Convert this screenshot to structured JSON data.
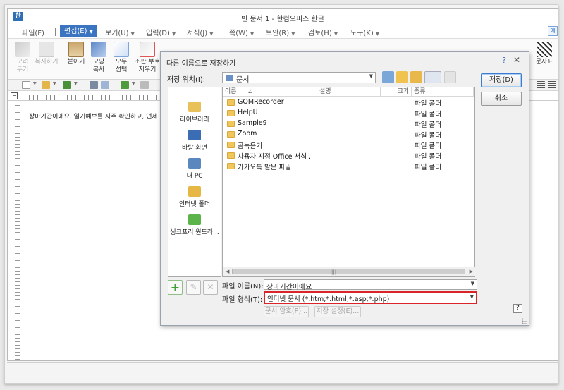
{
  "window": {
    "title": "빈 문서 1 - 한컴오피스 한글"
  },
  "menu": {
    "file": "파일(F)",
    "edit": "편집(E)",
    "view": "보기(U)",
    "input": "입력(D)",
    "format": "서식(J)",
    "page": "쪽(W)",
    "security": "보안(R)",
    "review": "검토(H)",
    "tools": "도구(K)"
  },
  "ribbon": {
    "cut": "오려\n두기",
    "copy": "복사하기",
    "paste": "붙이기",
    "shape_copy": "모양\n복사",
    "select_all": "모두\n선택",
    "clear_symbol": "조판 부호\n지우기",
    "char_table": "문자표"
  },
  "document": {
    "text": "장마기간이에요. 일기예보를 자주 확인하고, 언제 비"
  },
  "dialog": {
    "title": "다른 이름으로 저장하기",
    "help": "?",
    "close": "✕",
    "location_label": "저장 위치(I):",
    "location_value": "문서",
    "save_button": "저장(D)",
    "cancel_button": "취소",
    "places": [
      {
        "label": "라이브러리"
      },
      {
        "label": "바탕 화면"
      },
      {
        "label": "내 PC"
      },
      {
        "label": "인터넷 폴더"
      },
      {
        "label": "씽크프리 원드라..."
      }
    ],
    "columns": {
      "name": "이름",
      "desc": "설명",
      "size": "크기",
      "type": "종류"
    },
    "files": [
      {
        "name": "GOMRecorder",
        "type": "파일 폴더"
      },
      {
        "name": "HelpU",
        "type": "파일 폴더"
      },
      {
        "name": "Sample9",
        "type": "파일 폴더"
      },
      {
        "name": "Zoom",
        "type": "파일 폴더"
      },
      {
        "name": "곰녹음기",
        "type": "파일 폴더"
      },
      {
        "name": "사용자 지정 Office 서식 ...",
        "type": "파일 폴더"
      },
      {
        "name": "카카오톡 받은 파일",
        "type": "파일 폴더"
      }
    ],
    "filename_label": "파일 이름(N):",
    "filename_value": "장마기간이에요",
    "filetype_label": "파일 형식(T):",
    "filetype_value": "인터넷 문서 (*.htm;*.html;*.asp;*.php)",
    "doc_password": "문서 암호(P)...",
    "save_settings": "저장 설정(E)...",
    "question": "?"
  },
  "colors": {
    "highlight": "#d9252a",
    "accent": "#3b74c1"
  }
}
